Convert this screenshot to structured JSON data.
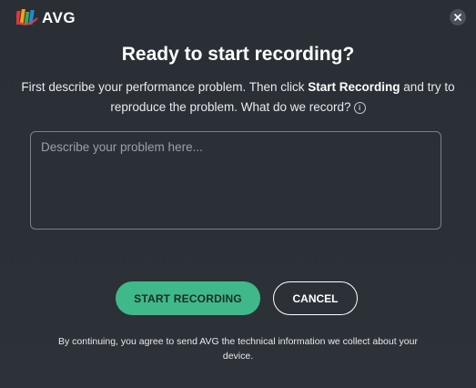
{
  "app": {
    "brand": "AVG",
    "brand_colors": [
      "#e03a3e",
      "#f4a11d",
      "#3aa757",
      "#1f8dd6"
    ],
    "accent_color": "#3fb989"
  },
  "dialog": {
    "close_icon": "close-icon",
    "title": "Ready to start recording?",
    "description_prefix": "First describe your performance problem. Then click ",
    "description_bold": "Start Recording",
    "description_suffix": " and try to reproduce the problem. What do we record?",
    "info_icon": "info-icon",
    "problem_placeholder": "Describe your problem here...",
    "problem_value": "",
    "start_button_label": "START RECORDING",
    "cancel_button_label": "CANCEL",
    "consent_text": "By continuing, you agree to send AVG the technical information we collect about your device."
  }
}
